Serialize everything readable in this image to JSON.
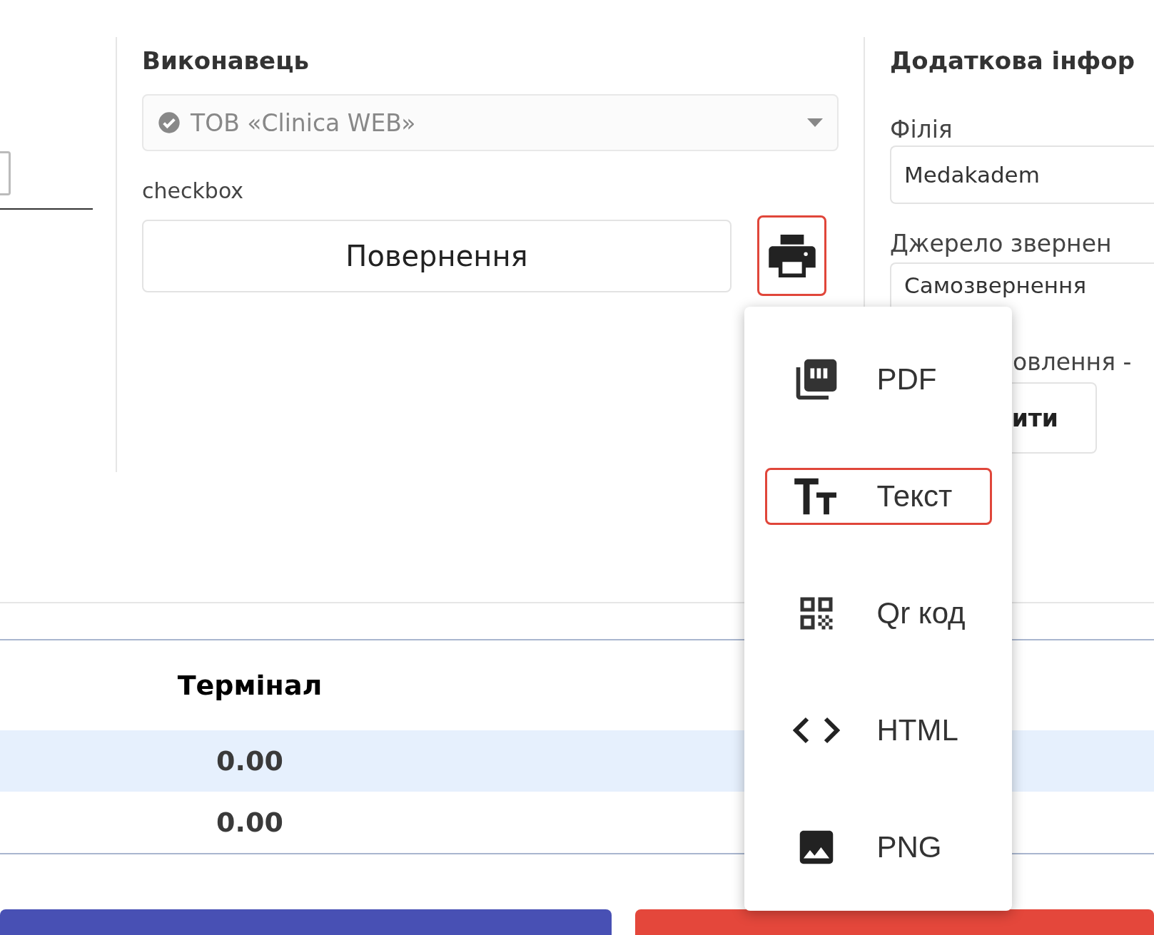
{
  "executor": {
    "heading": "Виконавець",
    "value": "ТОВ «Clinica WEB»",
    "disabled": true,
    "checkbox_label": "checkbox",
    "return_button": "Повернення",
    "print_focused": true
  },
  "additional": {
    "heading": "Додаткова інфор",
    "branch_label": "Філія",
    "branch_value": "Medakadem",
    "source_label": "Джерело звернен",
    "source_value": "Самозвернення",
    "label_3": "овлення -",
    "button": "ити"
  },
  "table": {
    "columns": [
      "Термінал"
    ],
    "rows": [
      {
        "cells": [
          "0.00"
        ],
        "selected": true
      },
      {
        "cells": [
          "0.00"
        ],
        "selected": false
      }
    ]
  },
  "bottom_buttons": [
    {
      "color": "#4850b4"
    },
    {
      "color": "#e4473b"
    }
  ],
  "print_menu": [
    {
      "kind": "pdf",
      "label": "PDF",
      "selected": false
    },
    {
      "kind": "text",
      "label": "Текст",
      "selected": true
    },
    {
      "kind": "qr",
      "label": "Qr код",
      "selected": false
    },
    {
      "kind": "html",
      "label": "HTML",
      "selected": false
    },
    {
      "kind": "png",
      "label": "PNG",
      "selected": false
    }
  ]
}
